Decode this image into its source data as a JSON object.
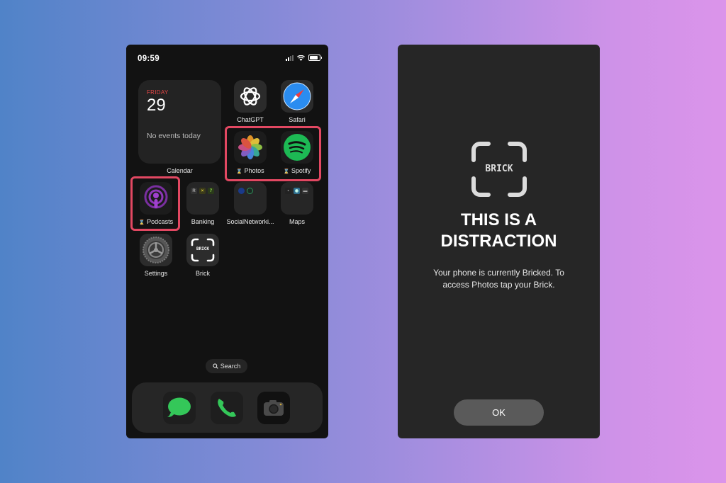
{
  "left_phone": {
    "status_bar": {
      "time": "09:59",
      "icons": [
        "cellular-signal-icon",
        "wifi-icon",
        "battery-icon"
      ]
    },
    "calendar_widget": {
      "day": "FRIDAY",
      "date": "29",
      "events_text": "No events today",
      "label": "Calendar"
    },
    "apps": [
      {
        "name": "ChatGPT",
        "label": "ChatGPT",
        "restricted": false
      },
      {
        "name": "Safari",
        "label": "Safari",
        "restricted": false
      },
      {
        "name": "Photos",
        "label": "Photos",
        "restricted": true
      },
      {
        "name": "Spotify",
        "label": "Spotify",
        "restricted": true
      },
      {
        "name": "Podcasts",
        "label": "Podcasts",
        "restricted": true
      },
      {
        "name": "Banking",
        "label": "Banking",
        "type": "folder"
      },
      {
        "name": "SocialNetworking",
        "label": "SocialNetworki...",
        "type": "folder"
      },
      {
        "name": "Maps",
        "label": "Maps",
        "type": "folder"
      },
      {
        "name": "Settings",
        "label": "Settings",
        "restricted": false
      },
      {
        "name": "Brick",
        "label": "Brick",
        "restricted": false
      }
    ],
    "restricted_marker": "⌛",
    "brick_icon_text": "BRICK",
    "search_label": "Search",
    "dock": [
      "Messages",
      "Phone",
      "Camera"
    ],
    "highlight_color": "#e24862"
  },
  "right_phone": {
    "logo_text": "BRICK",
    "title_line1": "THIS IS A",
    "title_line2": "DISTRACTION",
    "message": "Your phone is currently Bricked. To access Photos tap your Brick.",
    "ok_button": "OK"
  }
}
